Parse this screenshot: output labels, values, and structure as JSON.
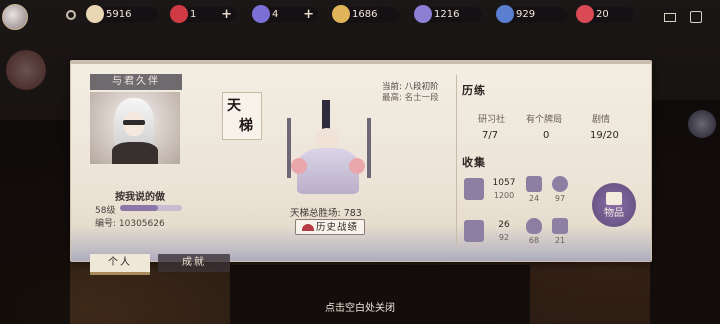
{
  "top_bar": {
    "resources": [
      {
        "name": "coin",
        "value": "5916",
        "color": "#e9d6b3"
      },
      {
        "name": "ruby",
        "value": "1",
        "color": "#d03a45",
        "has_plus": true
      },
      {
        "name": "amulet",
        "value": "4",
        "color": "#7b6fd6",
        "has_plus": true
      },
      {
        "name": "gold-ticket",
        "value": "1686",
        "color": "#e0b55a"
      },
      {
        "name": "stamina",
        "value": "1216",
        "color": "#8d7fd4"
      },
      {
        "name": "jade",
        "value": "929",
        "color": "#5b7fd0"
      },
      {
        "name": "heart",
        "value": "20",
        "color": "#d94a55"
      }
    ]
  },
  "profile": {
    "card_title": "与君久伴",
    "player_name": "按我说的做",
    "level_text": "58级",
    "level_progress": 0.62,
    "id_text": "编号: 10305626"
  },
  "tabs": {
    "personal": "个人",
    "achievements": "成就"
  },
  "rank": {
    "mark_line1": "天",
    "mark_line2": "梯",
    "current": "当前: 八段初阶",
    "highest": "最高: 名士一段",
    "wins": "天梯总胜场: 783",
    "history_button": "历史战绩"
  },
  "experience": {
    "heading": "历练",
    "stats": [
      {
        "label": "研习社",
        "value": "7/7"
      },
      {
        "label": "有个牌局",
        "value": "0"
      },
      {
        "label": "剧情",
        "value": "19/20"
      }
    ]
  },
  "collection": {
    "heading": "收集",
    "items": [
      {
        "name": "cards",
        "value": "1057",
        "total": "1200"
      },
      {
        "name": "portrait-cards",
        "value": "24"
      },
      {
        "name": "avatar",
        "value": "97"
      },
      {
        "name": "outfit",
        "value": "26",
        "total": "92"
      },
      {
        "name": "flame",
        "value": "68"
      },
      {
        "name": "emote",
        "value": "21"
      }
    ],
    "items_button": "物品"
  },
  "footer": {
    "hint": "点击空白处关闭"
  }
}
